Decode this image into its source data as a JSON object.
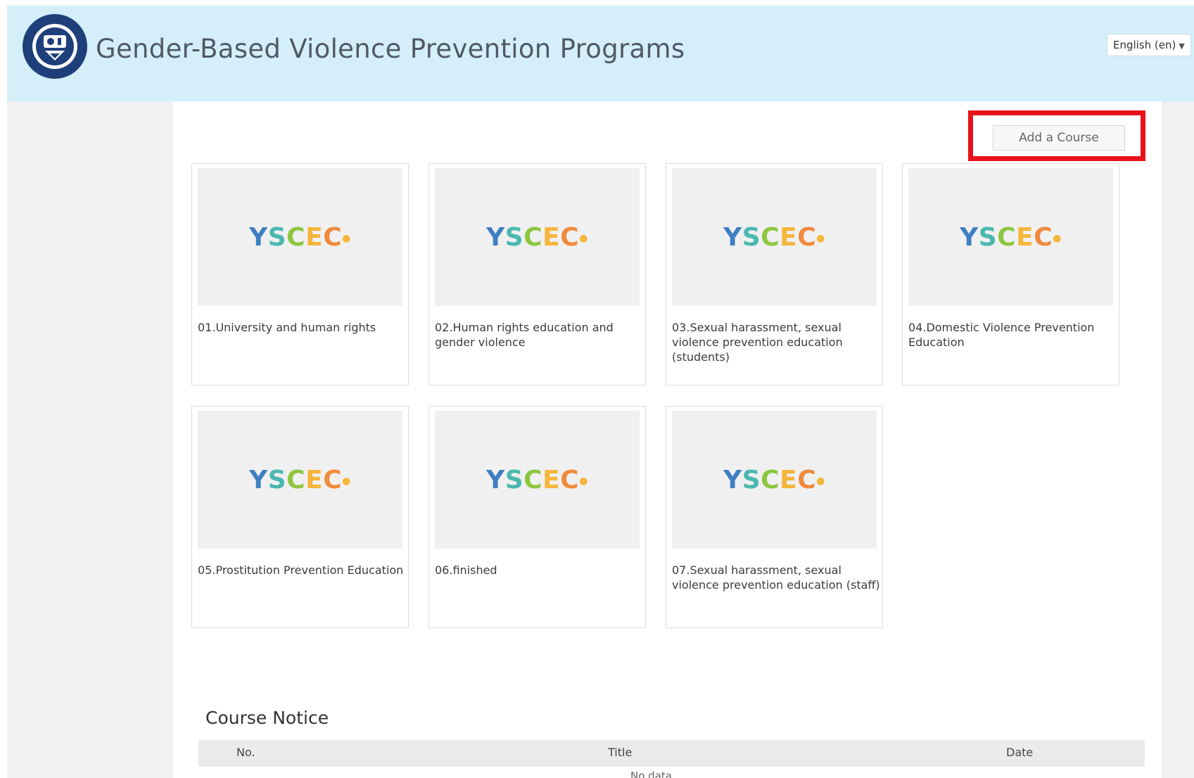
{
  "header": {
    "site_title": "Gender-Based Violence Prevention Programs",
    "language_selector": "English (en)",
    "logo_icon": "university-seal-icon"
  },
  "actions": {
    "add_course_label": "Add a Course",
    "highlight_color": "#e8121b"
  },
  "courses": [
    {
      "title": "01.University and human rights",
      "thumbnail": "YSCEC"
    },
    {
      "title": "02.Human rights education and gender violence",
      "thumbnail": "YSCEC"
    },
    {
      "title": "03.Sexual harassment, sexual violence prevention education (students)",
      "thumbnail": "YSCEC"
    },
    {
      "title": "04.Domestic Violence Prevention Education",
      "thumbnail": "YSCEC"
    },
    {
      "title": "05.Prostitution Prevention Education",
      "thumbnail": "YSCEC"
    },
    {
      "title": "06.finished",
      "thumbnail": "YSCEC"
    },
    {
      "title": "07.Sexual harassment, sexual violence prevention education (staff)",
      "thumbnail": "YSCEC"
    }
  ],
  "course_notice": {
    "heading": "Course Notice",
    "columns": [
      "No.",
      "Title",
      "Date"
    ],
    "empty_message": "No data"
  },
  "colors": {
    "header_bg": "#d4effa",
    "page_bg": "#f1f1f1",
    "thumb_bg": "#f0f0f0"
  }
}
